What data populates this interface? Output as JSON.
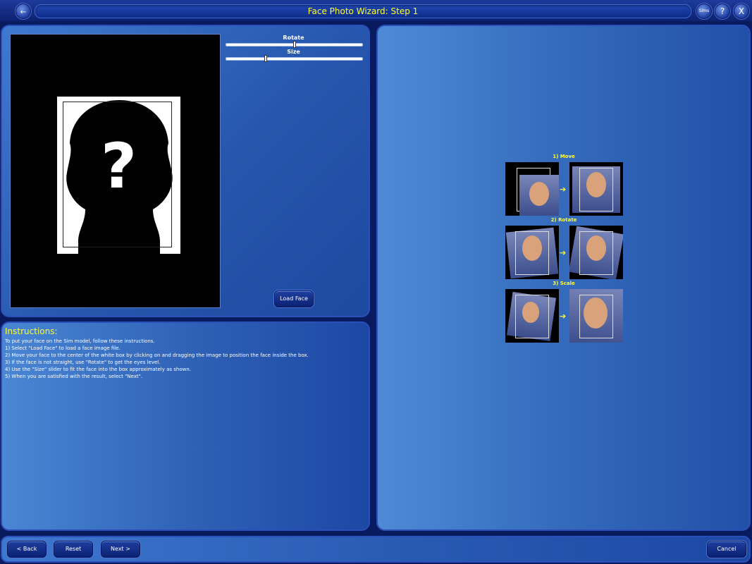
{
  "window": {
    "title": "Face Photo Wizard: Step 1",
    "back_icon": "left-arrow-icon",
    "sims_label": "Sims",
    "help_label": "?",
    "close_label": "X"
  },
  "sliders": {
    "rotate": {
      "label": "Rotate",
      "value": 0.5
    },
    "size": {
      "label": "Size",
      "value": 0.29
    }
  },
  "load_face_label": "Load Face",
  "instructions": {
    "title": "Instructions:",
    "lines": [
      "To put your face on the Sim model, follow these instructions.",
      "1) Select \"Load Face\" to load a face image file.",
      "2) Move your face to the center of the white box by clicking on and dragging the image to position the face inside the box.",
      "3) If the face is not straight, use \"Rotate\" to get the eyes level.",
      "4) Use the \"Size\" slider to fit the face into the box approximately as shown.",
      "5) When you are satisfied with the result, select \"Next\"."
    ]
  },
  "steps": [
    {
      "label": "1) Move"
    },
    {
      "label": "2) Rotate"
    },
    {
      "label": "3) Scale"
    }
  ],
  "placeholder_glyph": "?",
  "bottom": {
    "back_label": "< Back",
    "reset_label": "Reset",
    "next_label": "Next >",
    "cancel_label": "Cancel"
  },
  "colors": {
    "title_text": "#ffff33",
    "panel_blue": "#2a5cb4",
    "background": "#0a1a5e"
  }
}
